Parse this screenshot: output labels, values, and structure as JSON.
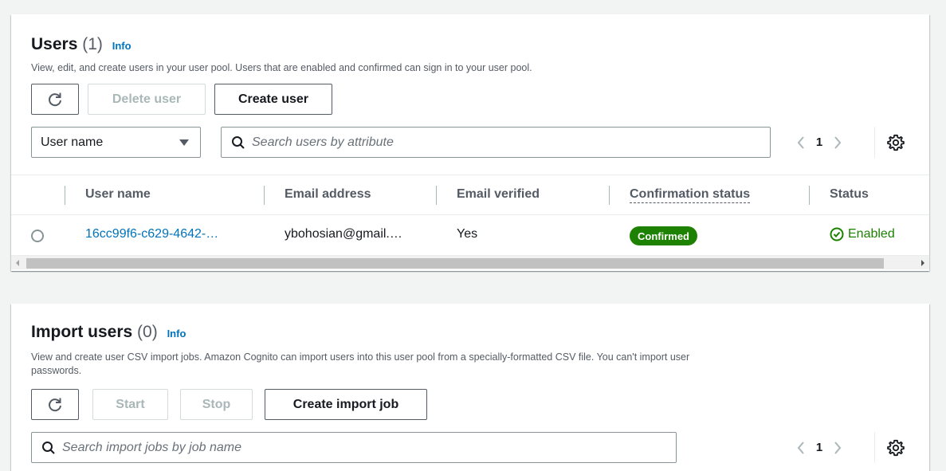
{
  "users": {
    "title": "Users",
    "count": "(1)",
    "info": "Info",
    "description": "View, edit, and create users in your user pool. Users that are enabled and confirmed can sign in to your user pool.",
    "refresh_icon": "refresh-icon",
    "delete_label": "Delete user",
    "create_label": "Create user",
    "filter_select": "User name",
    "search_placeholder": "Search users by attribute",
    "page": "1",
    "columns": [
      "User name",
      "Email address",
      "Email verified",
      "Confirmation status",
      "Status"
    ],
    "rows": [
      {
        "user_name": "16cc99f6-c629-4642-…",
        "email": "ybohosian@gmail.…",
        "email_verified": "Yes",
        "confirmation_status": "Confirmed",
        "status": "Enabled"
      }
    ]
  },
  "import_users": {
    "title": "Import users",
    "count": "(0)",
    "info": "Info",
    "description_line1": "View and create user CSV import jobs. Amazon Cognito can import users into this user pool from a specially-formatted CSV file. You can't import user",
    "description_line2": "passwords.",
    "start_label": "Start",
    "stop_label": "Stop",
    "create_label": "Create import job",
    "search_placeholder": "Search import jobs by job name",
    "page": "1"
  },
  "colors": {
    "link": "#0073bb",
    "success": "#1d8102",
    "text": "#16191f",
    "muted": "#545b64",
    "disabled": "#aab7b8"
  }
}
